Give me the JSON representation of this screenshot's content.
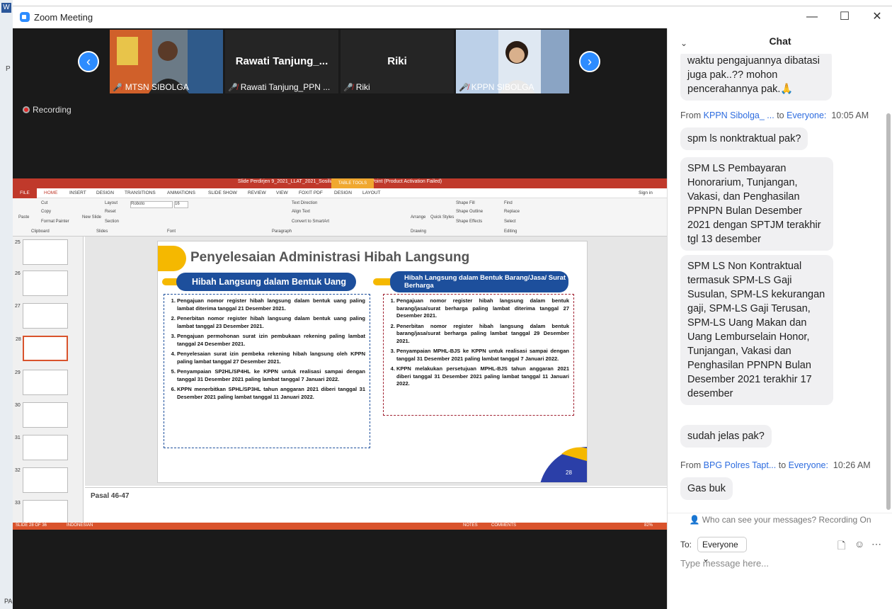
{
  "window": {
    "title": "Zoom Meeting",
    "min": "—",
    "max": "☐",
    "close": "✕"
  },
  "os": {
    "w": "W",
    "p": "P",
    "pa": "PA"
  },
  "participants": [
    {
      "name": "MTSN SIBOLGA",
      "big": ""
    },
    {
      "name": "Rawati Tanjung_PPN ...",
      "big": "Rawati  Tanjung_..."
    },
    {
      "name": "Riki",
      "big": "Riki"
    },
    {
      "name": "KPPN SIBOLGA",
      "big": ""
    }
  ],
  "recording": "Recording",
  "ppt": {
    "title": "Slide Perdirjen 9_2021_LLAT_2021_Sosiliasasi.pptx - PowerPoint (Product Activation Failed)",
    "table_tools": "TABLE TOOLS",
    "signin": "Sign in",
    "tabs": [
      "FILE",
      "HOME",
      "INSERT",
      "DESIGN",
      "TRANSITIONS",
      "ANIMATIONS",
      "SLIDE SHOW",
      "REVIEW",
      "VIEW",
      "FOXIT PDF",
      "DESIGN",
      "LAYOUT"
    ],
    "ribbon": {
      "paste": "Paste",
      "cut": "Cut",
      "copy": "Copy",
      "format_painter": "Format Painter",
      "clipboard": "Clipboard",
      "new_slide": "New Slide",
      "layout": "Layout",
      "reset": "Reset",
      "section": "Section",
      "slides": "Slides",
      "font_name": "Roboto",
      "font_size": "16",
      "font": "Font",
      "text_direction": "Text Direction",
      "align_text": "Align Text",
      "convert": "Convert to SmartArt",
      "paragraph": "Paragraph",
      "arrange": "Arrange",
      "quick_styles": "Quick Styles",
      "shape_fill": "Shape Fill",
      "shape_outline": "Shape Outline",
      "shape_effects": "Shape Effects",
      "drawing": "Drawing",
      "find": "Find",
      "replace": "Replace",
      "select": "Select",
      "editing": "Editing"
    },
    "thumb_numbers": [
      "25",
      "26",
      "27",
      "28",
      "29",
      "30",
      "31",
      "32",
      "33"
    ],
    "slide": {
      "title": "Penyelesaian Administrasi Hibah Langsung",
      "left_header": "Hibah Langsung dalam Bentuk Uang",
      "right_header": "Hibah Langsung dalam Bentuk Barang/Jasa/ Surat Berharga",
      "left_items": [
        "Pengajuan nomor register hibah langsung dalam bentuk uang paling lambat diterima tanggal 21 Desember 2021.",
        "Penerbitan nomor register hibah langsung dalam bentuk uang paling lambat tanggal 23 Desember 2021.",
        "Pengajuan permohonan surat izin pembukaan rekening paling lambat tanggal 24 Desember 2021.",
        "Penyelesaian surat izin pembeka rekening hibah langsung oleh KPPN paling lambat tanggal 27 Desember 2021.",
        "Penyampaian SP2HL/SP4HL ke KPPN untuk realisasi sampai dengan tanggal 31 Desember 2021 paling lambat tanggal 7 Januari 2022.",
        "KPPN menerbitkan SPHL/SP3HL tahun anggaran 2021 diberi tanggal 31 Desember 2021 paling lambat tanggal 11 Januari 2022."
      ],
      "right_items": [
        "Pengajuan nomor register hibah langsung dalam bentuk barang/jasa/surat berharga paling lambat diterima tanggal 27 Desember 2021.",
        "Penerbitan nomor register hibah langsung dalam bentuk barang/jasa/surat berharga paling lambat tanggal 29 Desember 2021.",
        "Penyampaian MPHL-BJS ke KPPN untuk realisasi sampai dengan tanggal 31 Desember 2021 paling lambat tanggal 7 Januari 2022.",
        "KPPN melakukan persetujuan MPHL-BJS tahun anggaran 2021 diberi tanggal 31 Desember 2021 paling lambat tanggal 11 Januari 2022."
      ],
      "page": "28"
    },
    "notes": "Pasal 46-47",
    "status": {
      "slide": "SLIDE 28 OF 36",
      "lang": "INDONESIAN",
      "notes": "NOTES",
      "comments": "COMMENTS",
      "zoom": "82%"
    }
  },
  "chat": {
    "title": "Chat",
    "messages": [
      {
        "type": "bubble",
        "text": "waktu pengajuannya dibatasi juga pak..?? mohon pencerahannya pak.🙏"
      },
      {
        "type": "meta",
        "from": "From",
        "name": "KPPN Sibolga_ ...",
        "to": "to",
        "target": "Everyone:",
        "time": "10:05 AM"
      },
      {
        "type": "bubble",
        "text": "spm ls nonktraktual pak?"
      },
      {
        "type": "bubble",
        "text": "SPM LS Pembayaran Honorarium, Tunjangan, Vakasi, dan Penghasilan PPNPN Bulan Desember 2021 dengan SPTJM terakhir tgl 13 desember"
      },
      {
        "type": "bubble",
        "text": "SPM LS Non Kontraktual termasuk SPM-LS Gaji Susulan, SPM-LS kekurangan gaji, SPM-LS Gaji Terusan, SPM-LS Uang Makan dan Uang Lemburselain Honor, Tunjangan, Vakasi dan Penghasilan PPNPN Bulan Desember 2021 terakhir 17 desember"
      },
      {
        "type": "bubble",
        "text": "sudah jelas pak?"
      },
      {
        "type": "meta",
        "from": "From",
        "name": "BPG Polres Tapt...",
        "to": "to",
        "target": "Everyone:",
        "time": "10:26 AM"
      },
      {
        "type": "bubble",
        "text": "Gas buk"
      }
    ],
    "who_can_see": "Who can see your messages? Recording On",
    "to_label": "To:",
    "to_value": "Everyone",
    "placeholder": "Type message here..."
  }
}
